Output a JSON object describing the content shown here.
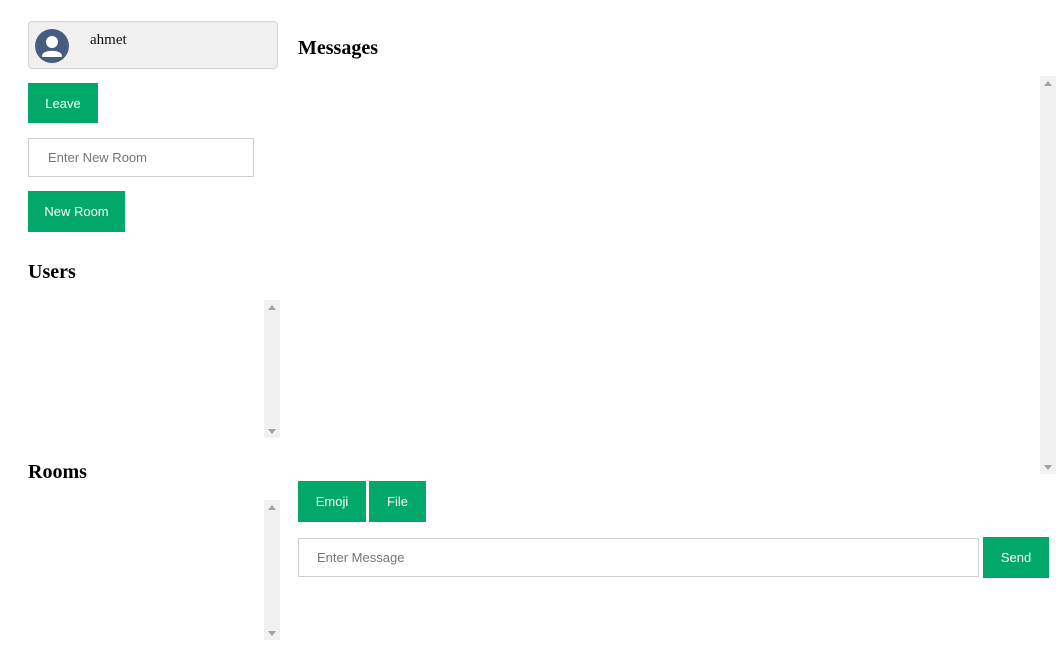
{
  "user": {
    "name": "ahmet",
    "avatar_icon": "user-avatar-icon"
  },
  "sidebar": {
    "leave_label": "Leave",
    "new_room_placeholder": "Enter New Room",
    "new_room_label": "New Room",
    "users_heading": "Users",
    "rooms_heading": "Rooms"
  },
  "main": {
    "messages_heading": "Messages",
    "emoji_label": "Emoji",
    "file_label": "File",
    "message_placeholder": "Enter Message",
    "send_label": "Send"
  },
  "colors": {
    "accent": "#02a86a",
    "avatar_bg": "#485c80"
  }
}
